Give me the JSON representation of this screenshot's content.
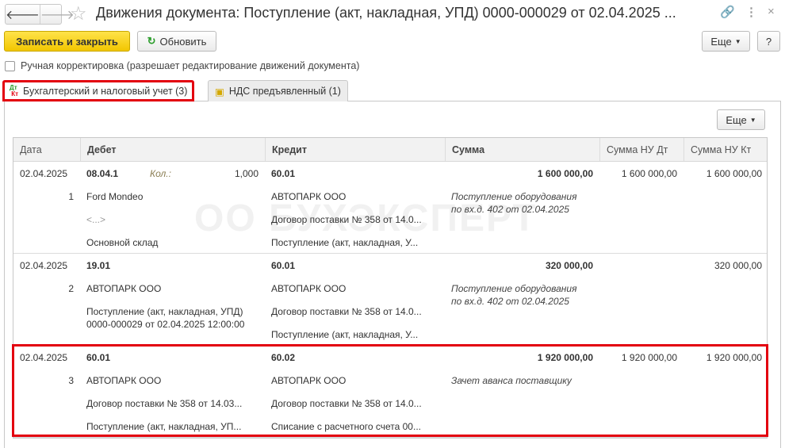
{
  "window": {
    "title": "Движения документа: Поступление (акт, накладная, УПД) 0000-000029 от 02.04.2025 ...",
    "icons": [
      "back-icon",
      "forward-icon",
      "star-icon",
      "link-icon",
      "more-icon",
      "close-icon"
    ]
  },
  "toolbar": {
    "save_close": "Записать и закрыть",
    "refresh": "Обновить",
    "more": "Еще",
    "help": "?"
  },
  "manual": {
    "label": "Ручная корректировка (разрешает редактирование движений документа)",
    "checked": false
  },
  "tabs": [
    {
      "label": "Бухгалтерский и налоговый учет (3)",
      "active": true
    },
    {
      "label": "НДС предъявленный (1)",
      "active": false
    }
  ],
  "table": {
    "more": "Еще",
    "columns": [
      "Дата",
      "Дебет",
      "Кредит",
      "Сумма",
      "Сумма НУ Дт",
      "Сумма НУ Кт"
    ],
    "rows": [
      {
        "date": "02.04.2025",
        "num": "1",
        "debit": {
          "account": "08.04.1",
          "qty_label": "Кол.:",
          "qty": "1,000",
          "lines": [
            "Ford Mondeo",
            "<...>",
            "Основной склад"
          ]
        },
        "credit": {
          "account": "60.01",
          "lines": [
            "АВТОПАРК ООО",
            "Договор поставки № 358 от 14.0...",
            "Поступление (акт, накладная, У..."
          ]
        },
        "sum": "1 600 000,00",
        "sum_note": "Поступление оборудования\nпо вх.д. 402 от 02.04.2025",
        "nu_dt": "1 600 000,00",
        "nu_kt": "1 600 000,00"
      },
      {
        "date": "02.04.2025",
        "num": "2",
        "debit": {
          "account": "19.01",
          "lines": [
            "АВТОПАРК ООО",
            "Поступление (акт, накладная, УПД)\n0000-000029 от 02.04.2025 12:00:00"
          ]
        },
        "credit": {
          "account": "60.01",
          "lines": [
            "АВТОПАРК ООО",
            "Договор поставки № 358 от 14.0...",
            "Поступление (акт, накладная, У..."
          ]
        },
        "sum": "320 000,00",
        "sum_note": "Поступление оборудования\nпо вх.д. 402 от 02.04.2025",
        "nu_dt": "",
        "nu_kt": "320 000,00"
      },
      {
        "date": "02.04.2025",
        "num": "3",
        "debit": {
          "account": "60.01",
          "lines": [
            "АВТОПАРК ООО",
            "Договор поставки № 358 от 14.03...",
            "Поступление (акт, накладная, УП..."
          ]
        },
        "credit": {
          "account": "60.02",
          "lines": [
            "АВТОПАРК ООО",
            "Договор поставки № 358 от 14.0...",
            "Списание с расчетного счета 00..."
          ]
        },
        "sum": "1 920 000,00",
        "sum_note": "Зачет аванса поставщику",
        "nu_dt": "1 920 000,00",
        "nu_kt": "1 920 000,00",
        "highlighted": true
      }
    ]
  },
  "watermark": "БУХЭКСПЕРТ",
  "colors": {
    "primary": "#f2c600",
    "highlight": "#e3000f"
  }
}
